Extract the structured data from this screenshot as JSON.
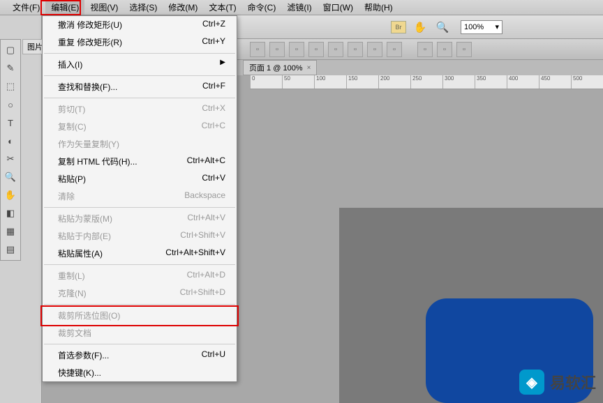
{
  "menubar": {
    "items": [
      "文件(F)",
      "编辑(E)",
      "视图(V)",
      "选择(S)",
      "修改(M)",
      "文本(T)",
      "命令(C)",
      "滤镜(I)",
      "窗口(W)",
      "帮助(H)"
    ],
    "open_index": 1
  },
  "toolbar": {
    "br_label": "Br",
    "zoom": "100%"
  },
  "tab": {
    "label": "页面 1 @ 100%",
    "close": "×"
  },
  "panel": {
    "side_label": "图片"
  },
  "ruler": {
    "ticks": [
      "0",
      "50",
      "100",
      "150",
      "200",
      "250",
      "300",
      "350",
      "400",
      "450",
      "500"
    ]
  },
  "dropdown": {
    "items": [
      {
        "label": "撤消 修改矩形(U)",
        "shortcut": "Ctrl+Z",
        "disabled": false
      },
      {
        "label": "重复 修改矩形(R)",
        "shortcut": "Ctrl+Y",
        "disabled": false
      },
      {
        "sep": true
      },
      {
        "label": "插入(I)",
        "shortcut": "",
        "arrow": true,
        "disabled": false
      },
      {
        "sep": true
      },
      {
        "label": "查找和替换(F)...",
        "shortcut": "Ctrl+F",
        "disabled": false
      },
      {
        "sep": true
      },
      {
        "label": "剪切(T)",
        "shortcut": "Ctrl+X",
        "disabled": true
      },
      {
        "label": "复制(C)",
        "shortcut": "Ctrl+C",
        "disabled": true
      },
      {
        "label": "作为矢量复制(Y)",
        "shortcut": "",
        "disabled": true
      },
      {
        "label": "复制 HTML 代码(H)...",
        "shortcut": "Ctrl+Alt+C",
        "disabled": false
      },
      {
        "label": "粘贴(P)",
        "shortcut": "Ctrl+V",
        "disabled": false
      },
      {
        "label": "清除",
        "shortcut": "Backspace",
        "disabled": true
      },
      {
        "sep": true
      },
      {
        "label": "粘贴为蒙版(M)",
        "shortcut": "Ctrl+Alt+V",
        "disabled": true
      },
      {
        "label": "粘贴于内部(E)",
        "shortcut": "Ctrl+Shift+V",
        "disabled": true
      },
      {
        "label": "粘贴属性(A)",
        "shortcut": "Ctrl+Alt+Shift+V",
        "disabled": false
      },
      {
        "sep": true
      },
      {
        "label": "重制(L)",
        "shortcut": "Ctrl+Alt+D",
        "disabled": true
      },
      {
        "label": "克隆(N)",
        "shortcut": "Ctrl+Shift+D",
        "disabled": true
      },
      {
        "sep": true
      },
      {
        "label": "裁剪所选位图(O)",
        "shortcut": "",
        "disabled": true
      },
      {
        "label": "裁剪文档",
        "shortcut": "",
        "disabled": true
      },
      {
        "sep": true
      },
      {
        "label": "首选参数(F)...",
        "shortcut": "Ctrl+U",
        "disabled": false
      },
      {
        "label": "快捷键(K)...",
        "shortcut": "",
        "disabled": false
      }
    ]
  },
  "watermark": {
    "text": "易软汇",
    "logo_char": "◈"
  },
  "tools": [
    "▢",
    "✎",
    "⬚",
    "○",
    "T",
    "◐",
    "✂",
    "🔍",
    "✋",
    "◧",
    "▦",
    "▤"
  ]
}
